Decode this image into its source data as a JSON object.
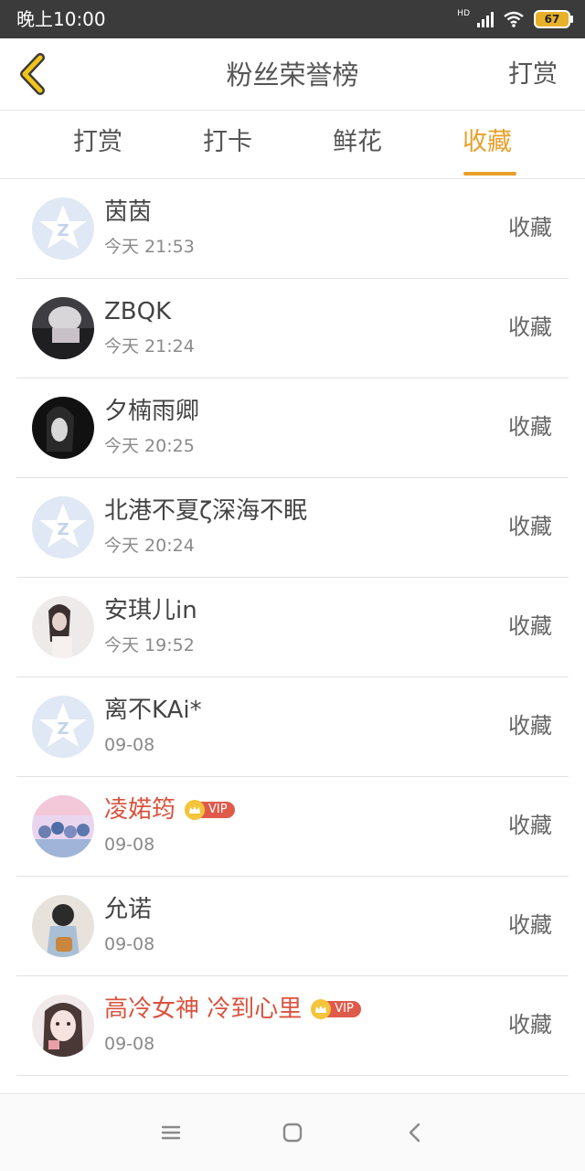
{
  "status_bar": {
    "time": "晚上10:00",
    "hd_label": "HD",
    "battery": "67"
  },
  "header": {
    "title": "粉丝荣誉榜",
    "right_link": "打赏"
  },
  "tabs": [
    {
      "label": "打赏",
      "active": false
    },
    {
      "label": "打卡",
      "active": false
    },
    {
      "label": "鲜花",
      "active": false
    },
    {
      "label": "收藏",
      "active": true
    }
  ],
  "fans": [
    {
      "name": "茵茵",
      "time": "今天 21:53",
      "action": "收藏",
      "vip": false,
      "avatar": "default-avatar"
    },
    {
      "name": "ZBQK",
      "time": "今天 21:24",
      "action": "收藏",
      "vip": false,
      "avatar": "photo-avatar"
    },
    {
      "name": "夕楠雨卿",
      "time": "今天 20:25",
      "action": "收藏",
      "vip": false,
      "avatar": "photo-avatar"
    },
    {
      "name": "北港不夏ζ深海不眠",
      "time": "今天 20:24",
      "action": "收藏",
      "vip": false,
      "avatar": "default-avatar"
    },
    {
      "name": "安琪儿in",
      "time": "今天 19:52",
      "action": "收藏",
      "vip": false,
      "avatar": "photo-avatar"
    },
    {
      "name": "离不KAi*",
      "time": "09-08",
      "action": "收藏",
      "vip": false,
      "avatar": "default-avatar"
    },
    {
      "name": "凌婼筠",
      "time": "09-08",
      "action": "收藏",
      "vip": true,
      "vip_label": "VIP",
      "avatar": "photo-avatar"
    },
    {
      "name": "允诺",
      "time": "09-08",
      "action": "收藏",
      "vip": false,
      "avatar": "photo-avatar"
    },
    {
      "name": "高冷女神 冷到心里",
      "time": "09-08",
      "action": "收藏",
      "vip": true,
      "vip_label": "VIP",
      "avatar": "photo-avatar"
    }
  ],
  "colors": {
    "accent": "#e8a02a",
    "vip_name": "#d9533f",
    "default_avatar": "#dfe8f4"
  }
}
